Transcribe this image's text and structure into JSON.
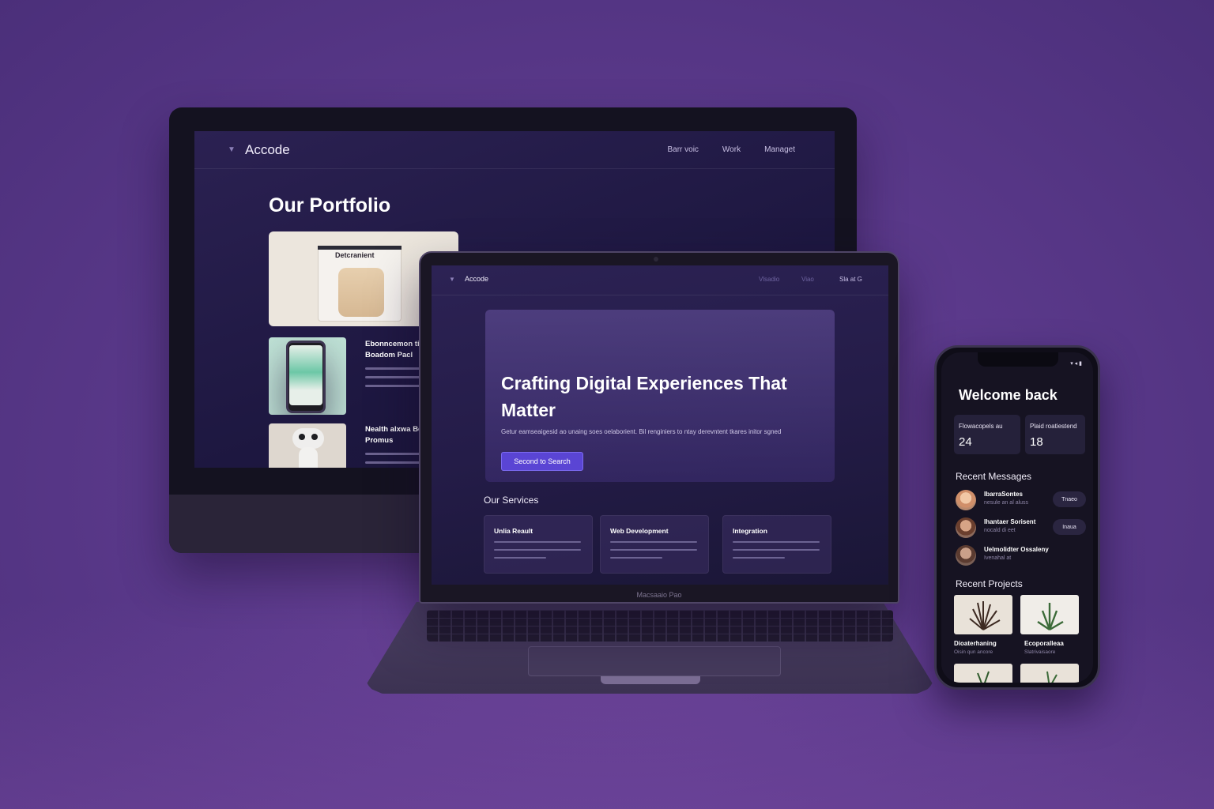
{
  "monitor": {
    "brand": "Accode",
    "nav_links": [
      "Barr voic",
      "Work",
      "Managet"
    ],
    "page_title": "Our Portfolio",
    "featured_card_label": "Detcranient",
    "items": [
      {
        "title": "Ebonncemon ti\nBoadom Pacl"
      },
      {
        "title": "Nealth alxwa Be\nPromus"
      }
    ]
  },
  "laptop": {
    "brand": "Accode",
    "nav_links": [
      "Vlsadio",
      "Viao",
      "Sla at G"
    ],
    "hero_title": "Crafting Digital Experiences That Matter",
    "hero_subtitle": "Getur eamseaigesid ao unaing soes oelaborient. Bil renginiers to ntay derevntent tkares initor sgned",
    "hero_button": "Second to Search",
    "services_title": "Our Services",
    "services": [
      {
        "title": "Unlia Reault"
      },
      {
        "title": "Web Development"
      },
      {
        "title": "Integration"
      }
    ],
    "model_label": "Macsaaio Pao"
  },
  "phone": {
    "status": "▾ ◂ ▮",
    "welcome": "Welcome back",
    "stats": [
      {
        "label": "Flowacopels au",
        "value": "24"
      },
      {
        "label": "Plaid roatiestend",
        "value": "18"
      }
    ],
    "messages_title": "Recent Messages",
    "messages": [
      {
        "name": "IbarraSontes",
        "snippet": "nesule an al aluss",
        "action": "Tnaeo"
      },
      {
        "name": "Ihantaer Sorisent",
        "snippet": "nocald di eet",
        "action": "Inaua"
      },
      {
        "name": "Uelmolidter Ossaleny",
        "snippet": "Ivenahal at",
        "action": ""
      }
    ],
    "projects_title": "Recent Projects",
    "projects": [
      {
        "title": "Dioaterhaning",
        "subtitle": "Oisin qun ancore"
      },
      {
        "title": "Ecoporalleaa",
        "subtitle": "Slatrivaisaore"
      }
    ]
  },
  "colors": {
    "background": "#5c3a8c",
    "accent_button": "#5a45d4",
    "screen_bg": "#241c48"
  }
}
